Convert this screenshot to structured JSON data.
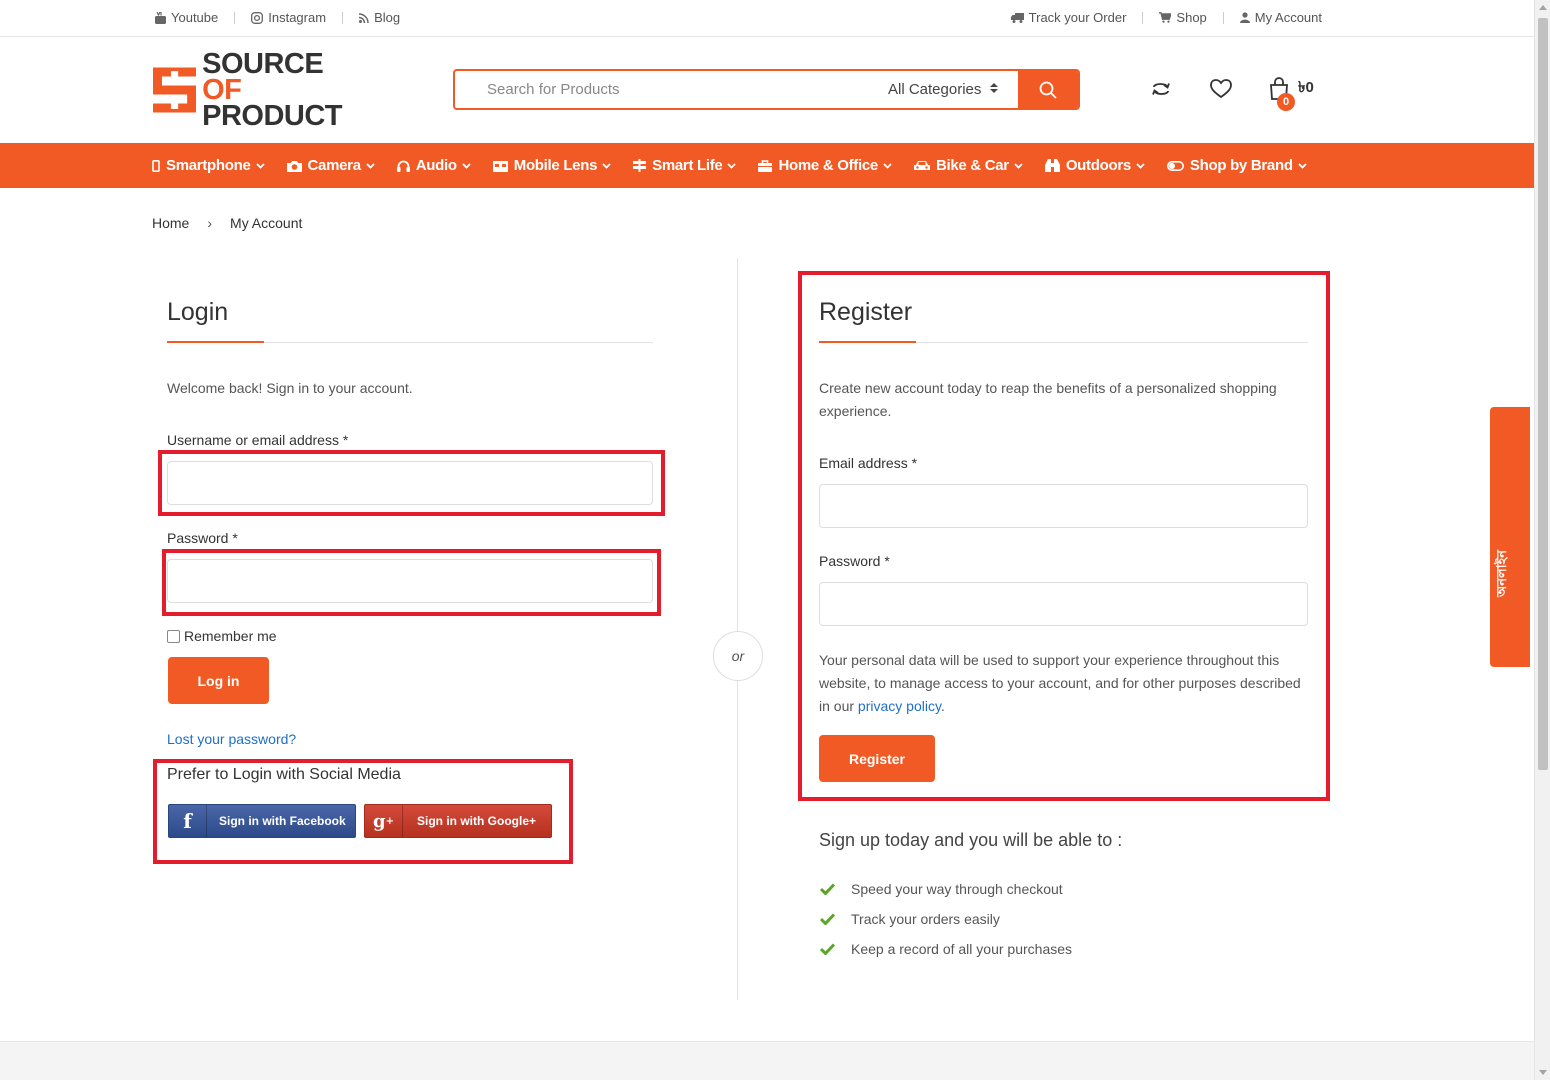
{
  "colors": {
    "accent": "#f15a24",
    "highlight": "#e31d2d",
    "link": "#1e6fc8",
    "check": "#5aa52a"
  },
  "topbar": {
    "left": [
      {
        "label": "Youtube",
        "icon": "youtube-icon"
      },
      {
        "label": "Instagram",
        "icon": "instagram-icon"
      },
      {
        "label": "Blog",
        "icon": "rss-icon"
      }
    ],
    "right": [
      {
        "label": "Track your Order",
        "icon": "truck-icon"
      },
      {
        "label": "Shop",
        "icon": "cart-icon"
      },
      {
        "label": "My Account",
        "icon": "user-icon"
      }
    ]
  },
  "logo": {
    "line1": "SOURCE",
    "of": "OF",
    "line2": "PRODUCT"
  },
  "search": {
    "placeholder": "Search for Products",
    "category": "All Categories"
  },
  "cart": {
    "count": "0",
    "amount": "৳0"
  },
  "nav": [
    {
      "label": "Smartphone",
      "icon": "phone-icon"
    },
    {
      "label": "Camera",
      "icon": "camera-icon"
    },
    {
      "label": "Audio",
      "icon": "headphones-icon"
    },
    {
      "label": "Mobile Lens",
      "icon": "lens-icon"
    },
    {
      "label": "Smart Life",
      "icon": "signpost-icon"
    },
    {
      "label": "Home & Office",
      "icon": "briefcase-icon"
    },
    {
      "label": "Bike & Car",
      "icon": "car-icon"
    },
    {
      "label": "Outdoors",
      "icon": "binoculars-icon"
    },
    {
      "label": "Shop by Brand",
      "icon": "toggle-icon"
    }
  ],
  "breadcrumb": {
    "home": "Home",
    "separator": "›",
    "current": "My Account"
  },
  "login": {
    "title": "Login",
    "intro": "Welcome back! Sign in to your account.",
    "username_label": "Username or email address *",
    "password_label": "Password *",
    "remember": "Remember me",
    "button": "Log in",
    "lost": "Lost your password?",
    "social_title": "Prefer to Login with Social Media",
    "facebook": "Sign in with Facebook",
    "google": "Sign in with Google+"
  },
  "or": "or",
  "register": {
    "title": "Register",
    "intro": "Create new account today to reap the benefits of a personalized shopping experience.",
    "email_label": "Email address *",
    "password_label": "Password *",
    "privacy_text": "Your personal data will be used to support your experience throughout this website, to manage access to your account, and for other purposes described in our",
    "privacy_link": "privacy policy",
    "privacy_end": ".",
    "button": "Register",
    "signup_title": "Sign up today and you will be able to :",
    "benefits": [
      "Speed your way through checkout",
      "Track your orders easily",
      "Keep a record of all your purchases"
    ]
  },
  "side_tab": "অনলাইন"
}
